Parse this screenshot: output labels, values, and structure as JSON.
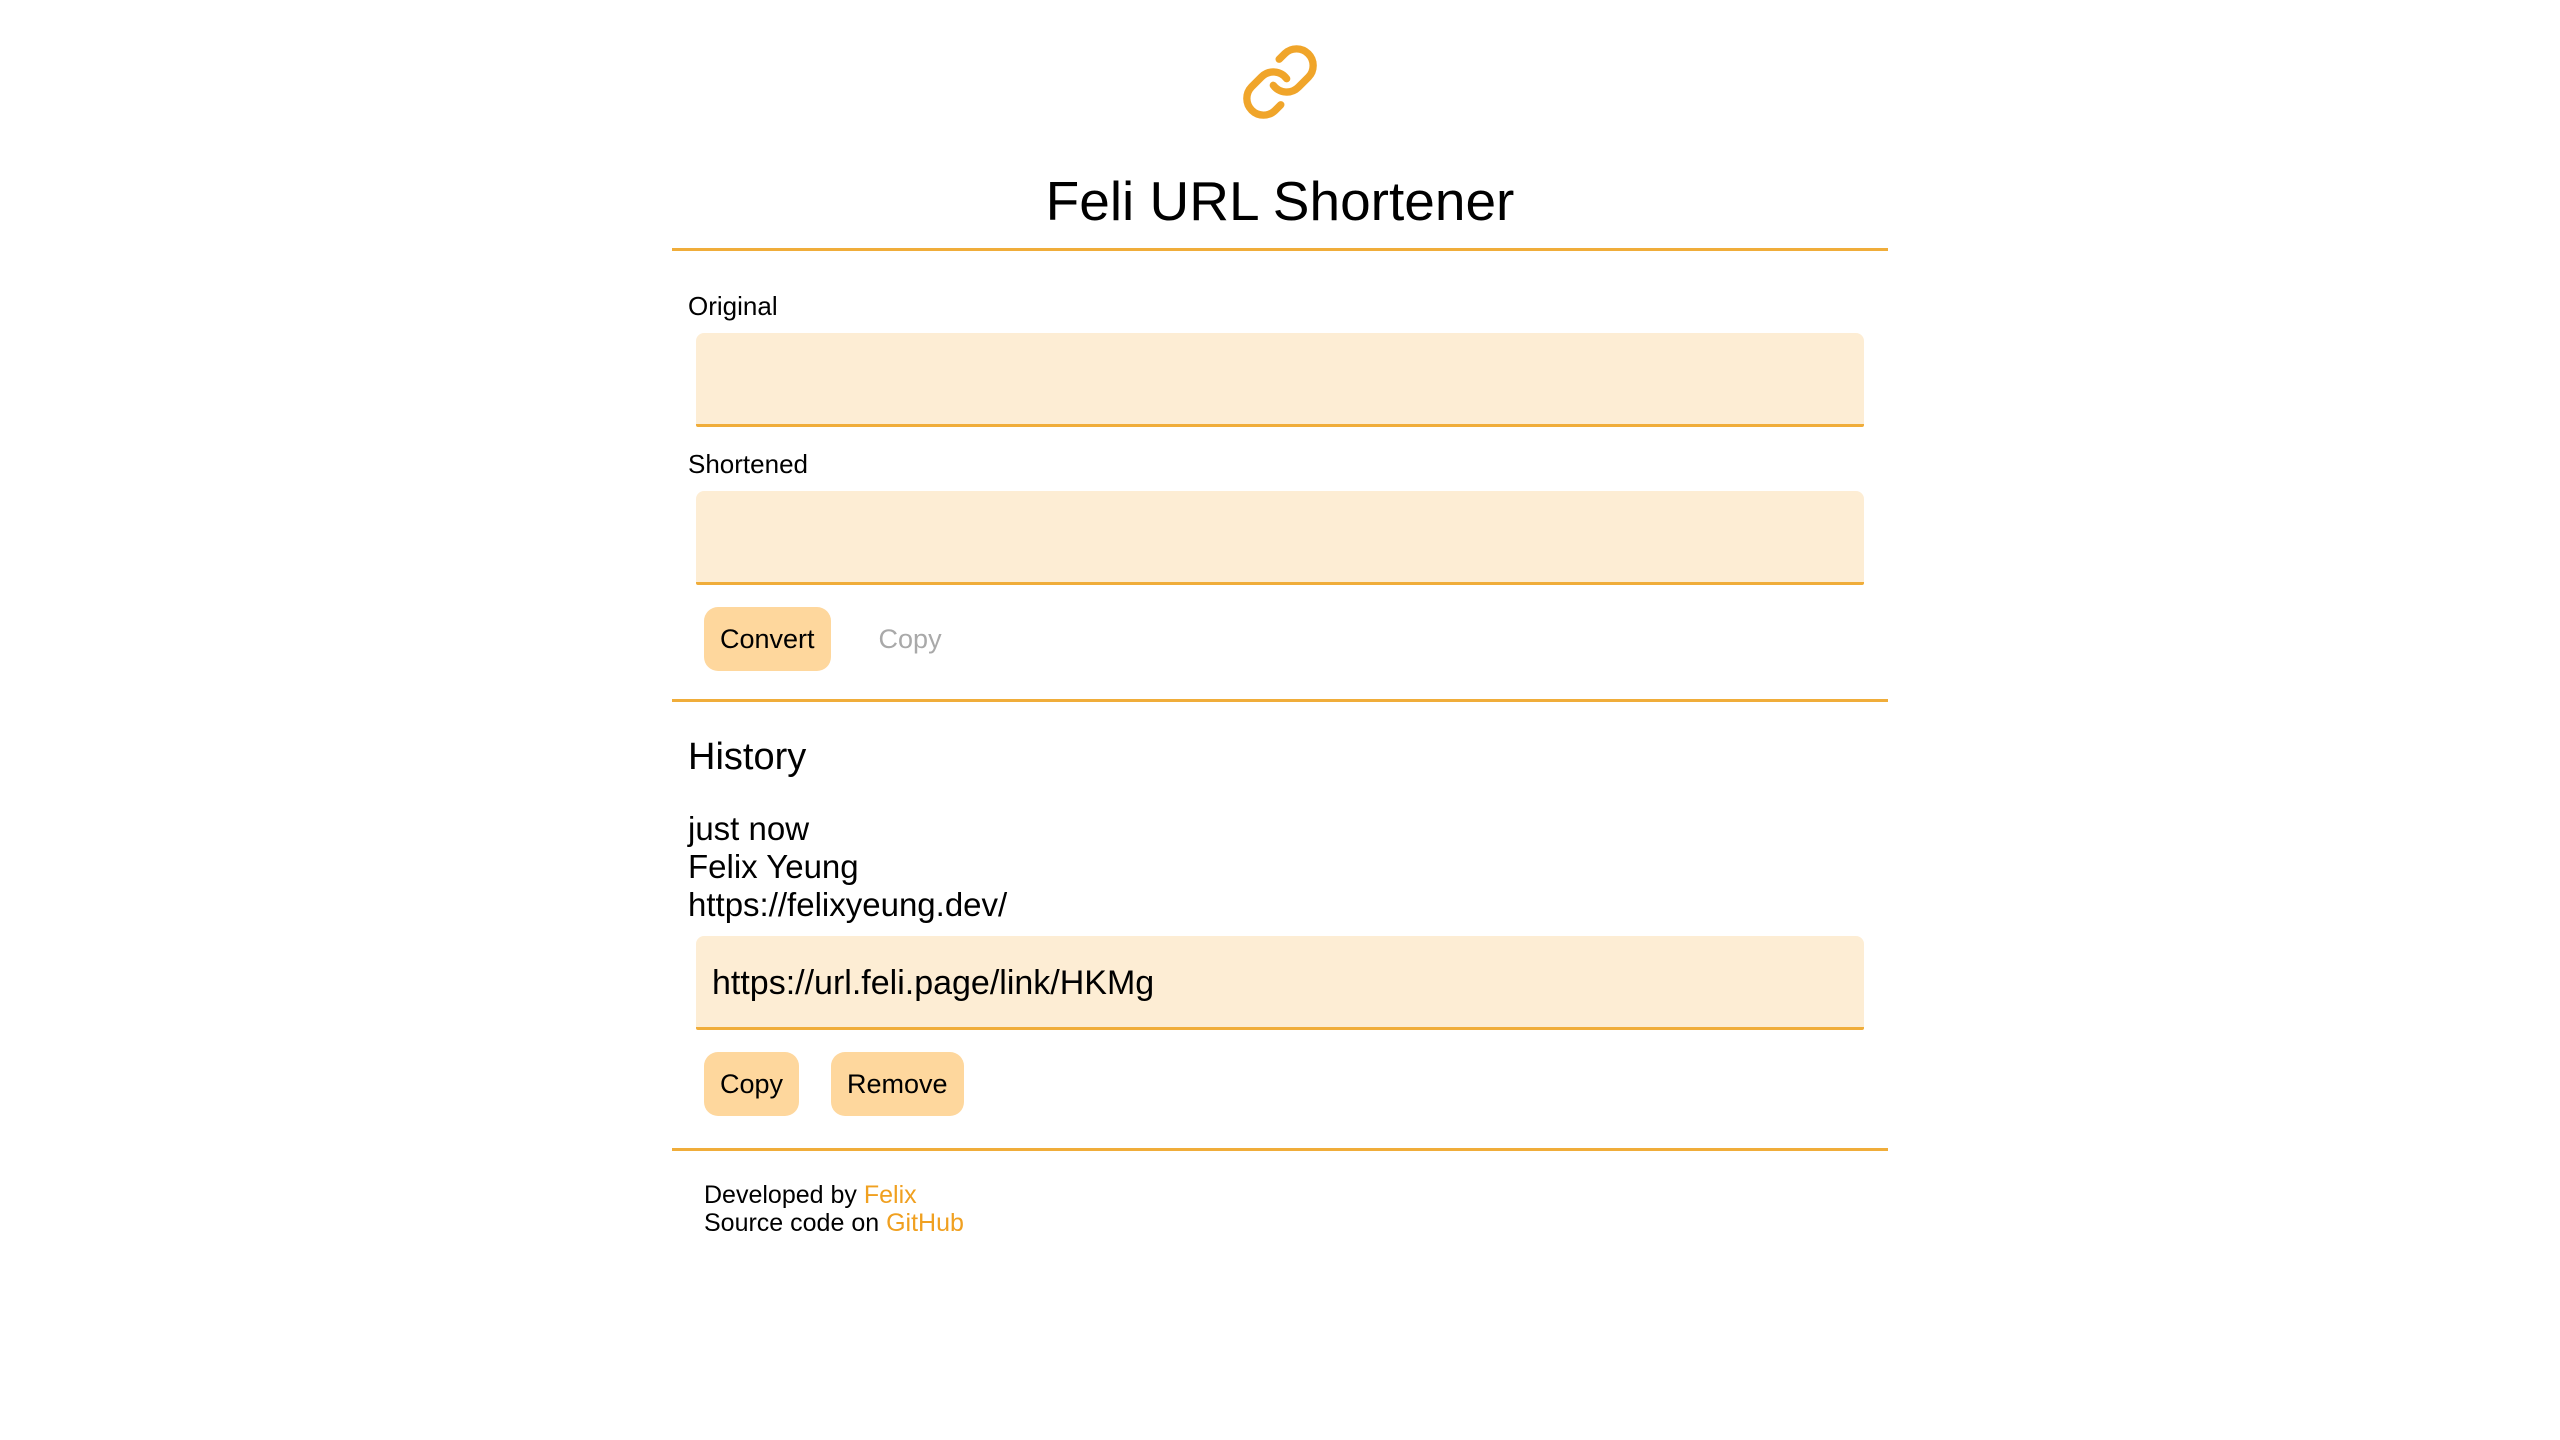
{
  "app": {
    "title": "Feli URL Shortener",
    "accent_color": "#f0ad3a",
    "field_bg_color": "#fdedd4",
    "button_color": "#fed79d",
    "logo_icon": "link-icon"
  },
  "converter": {
    "original_label": "Original",
    "original_value": "",
    "shortened_label": "Shortened",
    "shortened_value": "",
    "convert_label": "Convert",
    "copy_label": "Copy"
  },
  "history": {
    "heading": "History",
    "items": [
      {
        "time": "just now",
        "title": "Felix Yeung",
        "original_url": "https://felixyeung.dev/",
        "short_url": "https://url.feli.page/link/HKMg",
        "copy_label": "Copy",
        "remove_label": "Remove"
      }
    ]
  },
  "footer": {
    "developed_by_text": "Developed by",
    "developer_link": "Felix",
    "source_text": "Source code on",
    "source_link": "GitHub"
  }
}
